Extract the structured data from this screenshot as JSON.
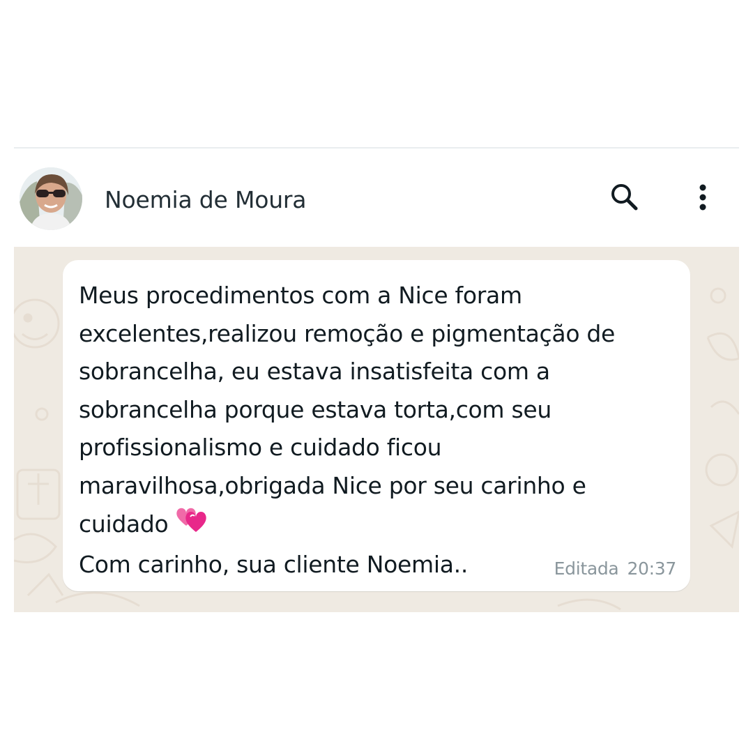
{
  "header": {
    "contact_name": "Noemia de Moura",
    "avatar_icon": "contact-avatar",
    "search_icon": "search-icon",
    "menu_icon": "more-vertical-icon"
  },
  "message": {
    "lines": [
      "Meus procedimentos com a Nice foram",
      "excelentes,realizou remoção e pigmentação de",
      "sobrancelha, eu estava insatisfeita com a",
      "sobrancelha porque estava torta,com seu",
      "profissionalismo e cuidado ficou",
      "maravilhosa,obrigada Nice por seu carinho e",
      "cuidado",
      "Com carinho, sua cliente Noemia.."
    ],
    "emoji_icon": "two-hearts-emoji",
    "edited_label": "Editada",
    "time": "20:37"
  },
  "colors": {
    "chat_background": "#efeae2",
    "bubble": "#ffffff",
    "text": "#111b21",
    "meta": "#8a969c"
  }
}
